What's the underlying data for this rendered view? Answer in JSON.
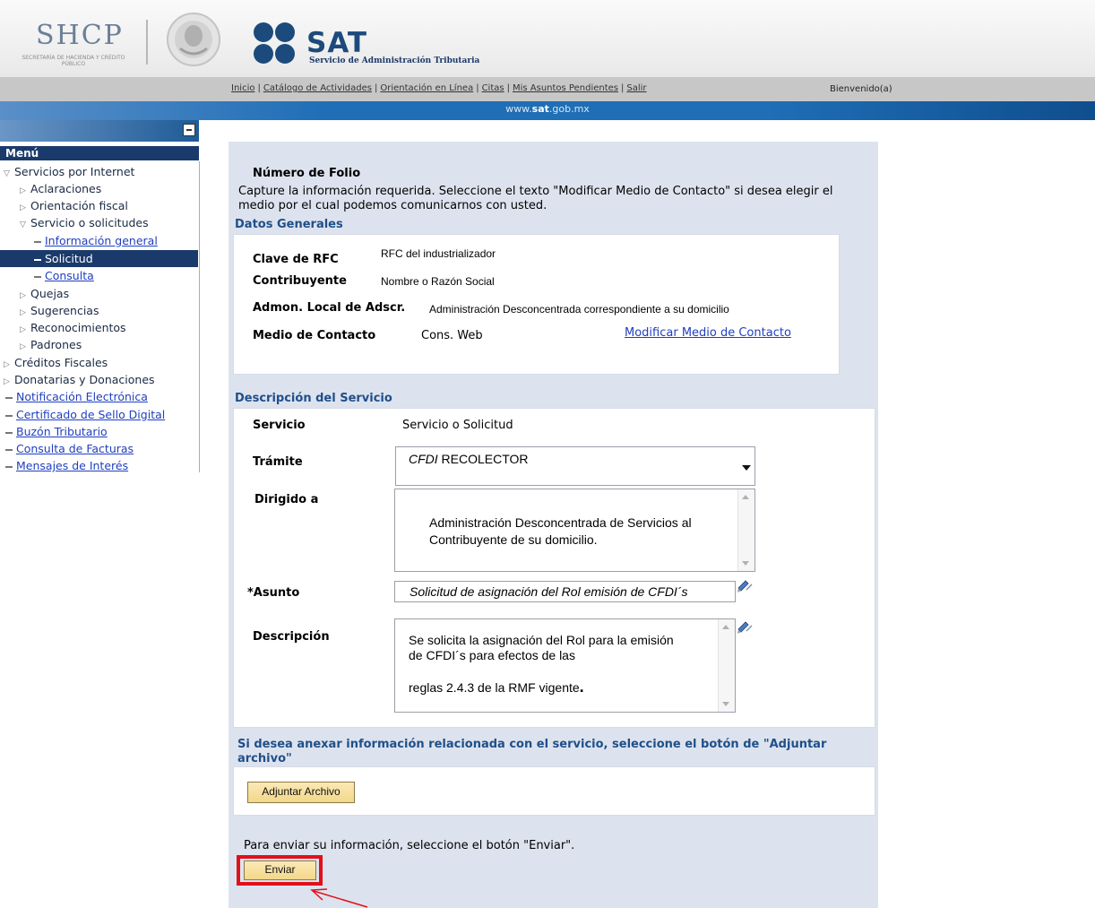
{
  "header": {
    "shcp_logo_text": "SHCP",
    "shcp_logo_subtext": "SECRETARÍA DE HACIENDA Y CRÉDITO PÚBLICO",
    "sat_logo_text": "SAT",
    "sat_subtitle": "Servicio de Administración Tributaria"
  },
  "nav": {
    "links": [
      "Inicio",
      "Catálogo de Actividades",
      "Orientación en Línea",
      "Citas",
      "Mis Asuntos Pendientes",
      "Salir"
    ],
    "welcome": "Bienvenido(a)"
  },
  "url_bar": {
    "prefix": "www.",
    "brand": "sat",
    "suffix": ".gob.mx"
  },
  "sidebar": {
    "menu_title": "Menú",
    "items": {
      "servicios_internet": "Servicios por Internet",
      "aclaraciones": "Aclaraciones",
      "orientacion": "Orientación fiscal",
      "servicio_solicitudes": "Servicio o solicitudes",
      "informacion_general": "Información general",
      "solicitud": "Solicitud",
      "consulta": "Consulta",
      "quejas": "Quejas",
      "sugerencias": "Sugerencias",
      "reconocimientos": "Reconocimientos",
      "padrones": "Padrones",
      "creditos": "Créditos Fiscales",
      "donatarias": "Donatarias y Donaciones",
      "notificacion": "Notificación Electrónica",
      "certificado": "Certificado de Sello Digital",
      "buzon": "Buzón Tributario",
      "facturas": "Consulta de Facturas",
      "mensajes": "Mensajes de Interés"
    }
  },
  "form": {
    "folio_title": "Número de Folio",
    "intro": "Capture la información requerida. Seleccione el texto \"Modificar Medio de Contacto\" si desea elegir el medio por el cual podemos comunicarnos con usted.",
    "datos_generales": {
      "title": "Datos Generales",
      "rfc_label": "Clave de RFC",
      "rfc_value": "RFC del industrializador",
      "contribuyente_label": "Contribuyente",
      "contribuyente_value": "Nombre o Razón Social",
      "admon_label": "Admon. Local de Adscr.",
      "admon_value": "Administración Desconcentrada  correspondiente a su domicilio",
      "medio_label": "Medio de Contacto",
      "medio_value": "Cons. Web",
      "modificar_link": "Modificar Medio de Contacto"
    },
    "descripcion_servicio": {
      "title": "Descripción del Servicio",
      "servicio_label": "Servicio",
      "servicio_value": "Servicio o Solicitud",
      "tramite_label": "Trámite",
      "tramite_value_italic": "CFDI",
      "tramite_value_rest": " RECOLECTOR",
      "dirigido_label": "Dirigido a",
      "dirigido_value": "Administración Desconcentrada de Servicios al Contribuyente de su domicilio.",
      "asunto_label": "*Asunto",
      "asunto_value": "Solicitud de asignación del Rol  emisión de CFDI´s",
      "descripcion_label": "Descripción",
      "descripcion_line1": "Se solicita la asignación del Rol para la emisión de CFDI´s para efectos  de las",
      "descripcion_line2": "reglas 2.4.3 de la RMF vigente",
      "descripcion_period": "."
    },
    "adjuntar": {
      "text": "Si desea anexar información relacionada con el servicio, seleccione el botón de \"Adjuntar archivo\"",
      "button": "Adjuntar Archivo"
    },
    "enviar": {
      "text": "Para enviar su información, seleccione el botón \"Enviar\".",
      "button": "Enviar"
    }
  },
  "colors": {
    "highlight": "#e0101a",
    "panel": "#dde3ee",
    "menu_dark": "#1a3a6b"
  }
}
